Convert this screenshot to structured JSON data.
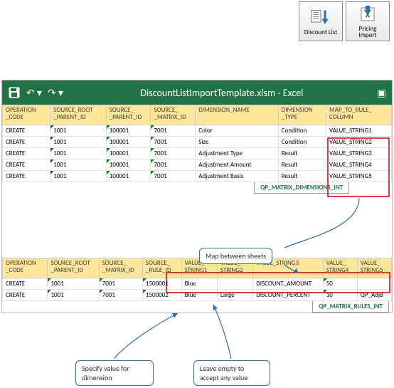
{
  "toolbar": {
    "discount_list": "Discount List",
    "pricing_import": "Pricing\nImport"
  },
  "excel": {
    "title": "DiscountListImportTemplate.xlsm - Excel"
  },
  "grid1": {
    "headers": [
      "OPERATION\n_CODE",
      "SOURCE_ROOT\n_PARENT_ID",
      "SOURCE_\n_PARENT_ID",
      "SOURCE_\n_MATRIX_ID",
      "DIMENSION_NAME",
      "DIMENSION\n_TYPE",
      "MAP_TO_RULE_\nCOLUMN"
    ],
    "rows": [
      [
        "CREATE",
        "1001",
        "100001",
        "7001",
        "Color",
        "Condition",
        "VALUE_STRING1"
      ],
      [
        "CREATE",
        "1001",
        "100001",
        "7001",
        "Size",
        "Condition",
        "VALUE_STRING2"
      ],
      [
        "CREATE",
        "1001",
        "100001",
        "7001",
        "Adjustment Type",
        "Result",
        "VALUE_STRING3"
      ],
      [
        "CREATE",
        "1001",
        "100001",
        "7001",
        "Adjustment Amount",
        "Result",
        "VALUE_STRING4"
      ],
      [
        "CREATE",
        "1001",
        "100001",
        "7001",
        "Adjustment Basis",
        "Result",
        "VALUE_STRING5"
      ]
    ],
    "sheet_tab": "QP_MATRIX_DIMENSIONS_INT"
  },
  "grid2": {
    "headers": [
      "OPERATION\n_CODE",
      "SOURCE_ROOT\n_PARENT_ID",
      "SOURCE_\n_MATRIX_ID",
      "SOURCE_\n_RULE_ID",
      "VALUE_\nSTRING1",
      "VALUE_\nSTRING2",
      "VALUE_STRING3",
      "VALUE_\nSTRING4",
      "VALUE_\nSTRING5"
    ],
    "rows": [
      [
        "CREATE",
        "1001",
        "7001",
        "1500001",
        "Blue",
        "",
        "DISCOUNT_AMOUNT",
        "50",
        ""
      ],
      [
        "CREATE",
        "1001",
        "7001",
        "1500002",
        "Blue",
        "Large",
        "DISCOUNT_PERCENT",
        "10",
        "QP_AdjB"
      ]
    ],
    "sheet_tab": "QP_MATRIX_RULES_INT"
  },
  "callouts": {
    "map": "Map between  sheets",
    "specify": "Specify value  for dimension",
    "leave": "Leave  empty to accept any value"
  }
}
